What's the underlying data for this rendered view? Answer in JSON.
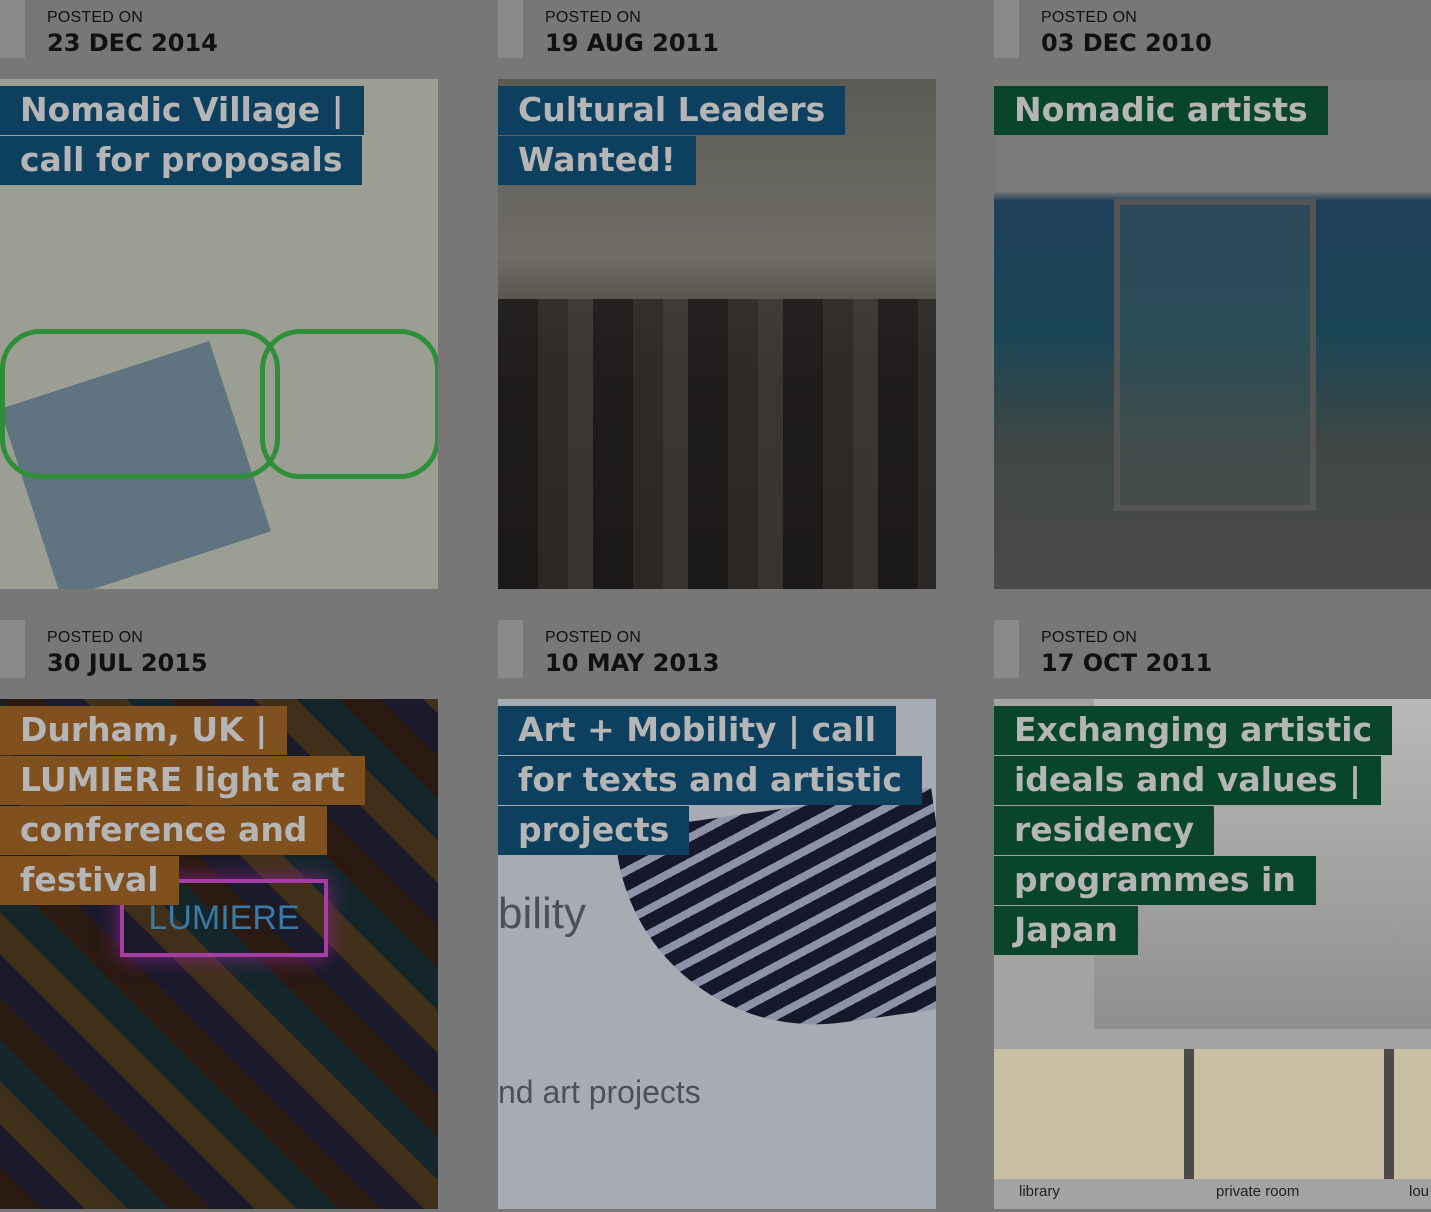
{
  "posted_label": "POSTED ON",
  "posts": [
    {
      "date": "23 DEC 2014",
      "title": "Nomadic Village | call for proposals",
      "accent": "#0d3f5f"
    },
    {
      "date": "19 AUG 2011",
      "title": "Cultural Leaders Wanted!",
      "accent": "#0d3f5f"
    },
    {
      "date": "03 DEC 2010",
      "title": "Nomadic artists",
      "accent": "#09452a"
    },
    {
      "date": "30 JUL 2015",
      "title": "Durham, UK | LUMIERE light art conference and festival",
      "accent": "#80501f"
    },
    {
      "date": "10 MAY 2013",
      "title": "Art + Mobility | call for texts and artistic projects",
      "accent": "#0d3f5f"
    },
    {
      "date": "17 OCT 2011",
      "title": "Exchanging artistic ideals and values | residency programmes in Japan",
      "accent": "#09452a"
    }
  ],
  "thumbs": {
    "lumiere_sign": "LUMIERE",
    "wing_text_top": "bility",
    "wing_text_bottom": "nd art projects",
    "japan_captions": [
      "library",
      "private room",
      "lou"
    ]
  }
}
